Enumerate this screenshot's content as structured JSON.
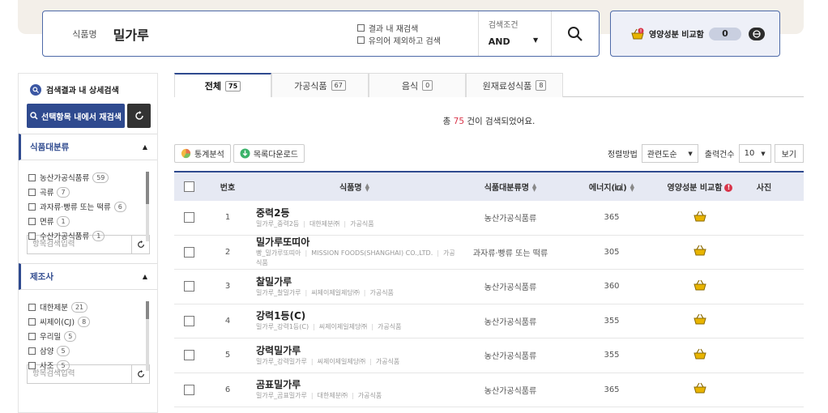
{
  "search": {
    "label": "식품명",
    "query": "밀가루",
    "options": [
      "결과 내 재검색",
      "유의어 제외하고 검색"
    ],
    "cond_label": "검색조건",
    "cond_value": "AND"
  },
  "compare": {
    "label": "영양성분 비교함",
    "count": "0"
  },
  "sidebar": {
    "head": "검색결과 내 상세검색",
    "rescan_button": "선택항목 내에서 재검색",
    "sections": [
      {
        "title": "식품대분류",
        "items": [
          {
            "label": "농산가공식품류",
            "count": "59"
          },
          {
            "label": "곡류",
            "count": "7"
          },
          {
            "label": "과자류·빵류 또는 떡류",
            "count": "6"
          },
          {
            "label": "면류",
            "count": "1"
          },
          {
            "label": "수산가공식품류",
            "count": "1"
          }
        ],
        "placeholder": "항목검색입력"
      },
      {
        "title": "제조사",
        "items": [
          {
            "label": "대한제분",
            "count": "21"
          },
          {
            "label": "씨제이(CJ)",
            "count": "8"
          },
          {
            "label": "우리밀",
            "count": "5"
          },
          {
            "label": "삼양",
            "count": "5"
          },
          {
            "label": "사조",
            "count": "5"
          }
        ],
        "placeholder": "항목검색입력"
      }
    ]
  },
  "tabs": [
    {
      "label": "전체",
      "count": "75"
    },
    {
      "label": "가공식품",
      "count": "67"
    },
    {
      "label": "음식",
      "count": "0"
    },
    {
      "label": "원재료성식품",
      "count": "8"
    }
  ],
  "result": {
    "prefix": "총",
    "count": "75",
    "suffix": "건이 검색되었어요."
  },
  "toolbar": {
    "stats": "통계분석",
    "download": "목록다운로드",
    "sort_label": "정렬방법",
    "sort_value": "관련도순",
    "size_label": "출력건수",
    "size_value": "10",
    "view": "보기"
  },
  "table": {
    "headers": {
      "num": "번호",
      "name": "식품명",
      "cat": "식품대분류명",
      "energy": "에너지(㎉)",
      "compare": "영양성분 비교함",
      "photo": "사진"
    },
    "rows": [
      {
        "num": "1",
        "name": "중력2등",
        "sub": [
          "밀가루_중력2등",
          "대한제분㈜",
          "가공식품"
        ],
        "cat": "농산가공식품류",
        "energy": "365"
      },
      {
        "num": "2",
        "name": "밀가루또띠아",
        "sub": [
          "빵_밀가루또띠아",
          "MISSION FOODS(SHANGHAI) CO.,LTD.",
          "가공식품"
        ],
        "cat": "과자류·빵류 또는 떡류",
        "energy": "305"
      },
      {
        "num": "3",
        "name": "찰밀가루",
        "sub": [
          "밀가루_찰밀가루",
          "씨제이제일제당㈜",
          "가공식품"
        ],
        "cat": "농산가공식품류",
        "energy": "360"
      },
      {
        "num": "4",
        "name": "강력1등(C)",
        "sub": [
          "밀가루_강력1등(C)",
          "씨제이제일제당㈜",
          "가공식품"
        ],
        "cat": "농산가공식품류",
        "energy": "355"
      },
      {
        "num": "5",
        "name": "강력밀가루",
        "sub": [
          "밀가루_강력밀가루",
          "씨제이제일제당㈜",
          "가공식품"
        ],
        "cat": "농산가공식품류",
        "energy": "355"
      },
      {
        "num": "6",
        "name": "곰표밀가루",
        "sub": [
          "밀가루_곰표밀가루",
          "대한제분㈜",
          "가공식품"
        ],
        "cat": "농산가공식품류",
        "energy": "365"
      }
    ]
  }
}
